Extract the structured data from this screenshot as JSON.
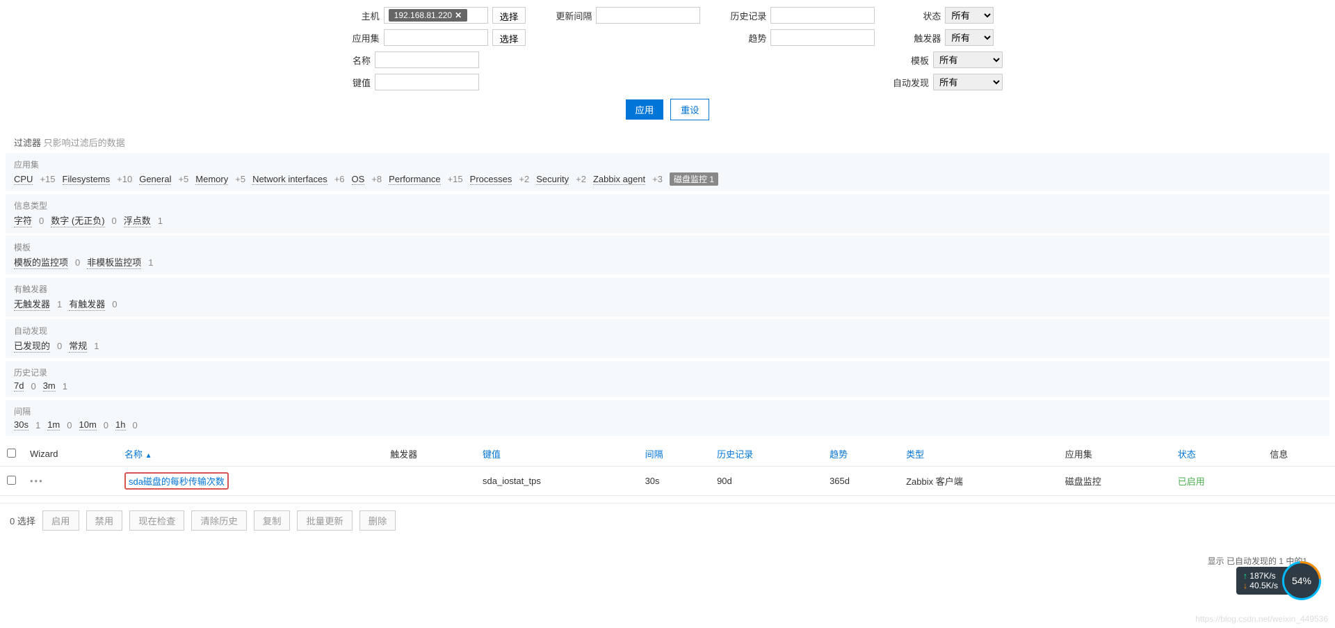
{
  "filter": {
    "host_label": "主机",
    "host_value": "192.168.81.220",
    "select_btn": "选择",
    "appset_label": "应用集",
    "name_label": "名称",
    "key_label": "键值",
    "update_label": "更新间隔",
    "history_label": "历史记录",
    "trend_label": "趋势",
    "state_label": "状态",
    "trigger_label": "触发器",
    "template_label": "模板",
    "discovery_label": "自动发现",
    "option_all": "所有",
    "apply_btn": "应用",
    "reset_btn": "重设"
  },
  "subfilter": {
    "title": "过滤器",
    "hint": "只影响过滤后的数据",
    "appset": {
      "label": "应用集",
      "items": [
        {
          "name": "CPU",
          "count": "+15"
        },
        {
          "name": "Filesystems",
          "count": "+10"
        },
        {
          "name": "General",
          "count": "+5"
        },
        {
          "name": "Memory",
          "count": "+5"
        },
        {
          "name": "Network interfaces",
          "count": "+6"
        },
        {
          "name": "OS",
          "count": "+8"
        },
        {
          "name": "Performance",
          "count": "+15"
        },
        {
          "name": "Processes",
          "count": "+2"
        },
        {
          "name": "Security",
          "count": "+2"
        },
        {
          "name": "Zabbix agent",
          "count": "+3"
        }
      ],
      "badge": {
        "name": "磁盘监控",
        "count": "1"
      }
    },
    "infotype": {
      "label": "信息类型",
      "items": [
        {
          "name": "字符",
          "count": "0"
        },
        {
          "name": "数字 (无正负)",
          "count": "0"
        },
        {
          "name": "浮点数",
          "count": "1",
          "link": true
        }
      ]
    },
    "template": {
      "label": "模板",
      "items": [
        {
          "name": "模板的监控项",
          "count": "0"
        },
        {
          "name": "非模板监控项",
          "count": "1",
          "link": true
        }
      ]
    },
    "trigger": {
      "label": "有触发器",
      "items": [
        {
          "name": "无触发器",
          "count": "1",
          "link": true
        },
        {
          "name": "有触发器",
          "count": "0"
        }
      ]
    },
    "discovery": {
      "label": "自动发现",
      "items": [
        {
          "name": "已发现的",
          "count": "0"
        },
        {
          "name": "常规",
          "count": "1",
          "link": true
        }
      ]
    },
    "history": {
      "label": "历史记录",
      "items": [
        {
          "name": "7d",
          "count": "0"
        },
        {
          "name": "3m",
          "count": "1",
          "link": true
        }
      ]
    },
    "interval": {
      "label": "间隔",
      "items": [
        {
          "name": "30s",
          "count": "1",
          "link": true
        },
        {
          "name": "1m",
          "count": "0"
        },
        {
          "name": "10m",
          "count": "0"
        },
        {
          "name": "1h",
          "count": "0"
        }
      ]
    }
  },
  "table": {
    "headers": {
      "wizard": "Wizard",
      "name": "名称",
      "triggers": "触发器",
      "key": "键值",
      "interval": "间隔",
      "history": "历史记录",
      "trend": "趋势",
      "type": "类型",
      "appset": "应用集",
      "status": "状态",
      "info": "信息"
    },
    "sort_indicator": "▲",
    "rows": [
      {
        "name": "sda磁盘的每秒传输次数",
        "key": "sda_iostat_tps",
        "interval": "30s",
        "history": "90d",
        "trend": "365d",
        "type": "Zabbix 客户端",
        "appset": "磁盘监控",
        "status": "已启用"
      }
    ]
  },
  "footer": {
    "selected": "0 选择",
    "enable": "启用",
    "disable": "禁用",
    "check_now": "现在检查",
    "clear_history": "清除历史",
    "copy": "复制",
    "mass_update": "批量更新",
    "delete": "删除"
  },
  "summary": "显示 已自动发现的 1 中的1",
  "widget": {
    "up": "187K/s",
    "down": "40.5K/s",
    "pct": "54%"
  },
  "watermark": "https://blog.csdn.net/weixin_449536"
}
